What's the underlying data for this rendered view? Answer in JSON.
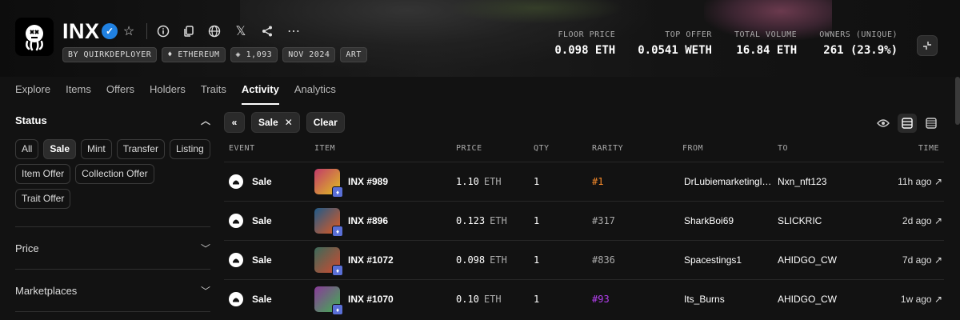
{
  "collection": {
    "name": "INX",
    "tags": [
      "BY QUIRKDEPLOYER",
      "♦ ETHEREUM",
      "◈ 1,093",
      "NOV 2024",
      "ART"
    ]
  },
  "stats": [
    {
      "label": "FLOOR PRICE",
      "value": "0.098 ETH"
    },
    {
      "label": "TOP OFFER",
      "value": "0.0541 WETH"
    },
    {
      "label": "TOTAL VOLUME",
      "value": "16.84 ETH"
    },
    {
      "label": "OWNERS (UNIQUE)",
      "value": "261 (23.9%)"
    }
  ],
  "tabs": [
    "Explore",
    "Items",
    "Offers",
    "Holders",
    "Traits",
    "Activity",
    "Analytics"
  ],
  "active_tab": "Activity",
  "sidebar": {
    "status_title": "Status",
    "status_chips": [
      "All",
      "Sale",
      "Mint",
      "Transfer",
      "Listing",
      "Item Offer",
      "Collection Offer",
      "Trait Offer"
    ],
    "active_chip": "Sale",
    "price_title": "Price",
    "marketplaces_title": "Marketplaces"
  },
  "toolbar": {
    "filter_label": "Sale",
    "clear_label": "Clear"
  },
  "table": {
    "headers": {
      "event": "EVENT",
      "item": "ITEM",
      "price": "PRICE",
      "qty": "QTY",
      "rarity": "RARITY",
      "from": "FROM",
      "to": "TO",
      "time": "TIME"
    },
    "rows": [
      {
        "event": "Sale",
        "item": "INX #989",
        "price": "1.10",
        "currency": "ETH",
        "qty": "1",
        "rarity": "#1",
        "rarity_color": "#f58a2a",
        "from": "DrLubiemarketingli...",
        "to": "Nxn_nft123",
        "time": "11h ago",
        "thumb": [
          "#c23a6a",
          "#e0c020"
        ]
      },
      {
        "event": "Sale",
        "item": "INX #896",
        "price": "0.123",
        "currency": "ETH",
        "qty": "1",
        "rarity": "#317",
        "rarity_color": "#aaaaaa",
        "from": "SharkBoi69",
        "to": "SLICKRIC",
        "time": "2d ago",
        "thumb": [
          "#1f5a8a",
          "#e05a20"
        ]
      },
      {
        "event": "Sale",
        "item": "INX #1072",
        "price": "0.098",
        "currency": "ETH",
        "qty": "1",
        "rarity": "#836",
        "rarity_color": "#aaaaaa",
        "from": "Spacestings1",
        "to": "AHIDGO_CW",
        "time": "7d ago",
        "thumb": [
          "#3a6a5a",
          "#d04a30"
        ]
      },
      {
        "event": "Sale",
        "item": "INX #1070",
        "price": "0.10",
        "currency": "ETH",
        "qty": "1",
        "rarity": "#93",
        "rarity_color": "#b43ff0",
        "from": "Its_Burns",
        "to": "AHIDGO_CW",
        "time": "1w ago",
        "thumb": [
          "#8a3a9a",
          "#40b050"
        ]
      }
    ]
  }
}
